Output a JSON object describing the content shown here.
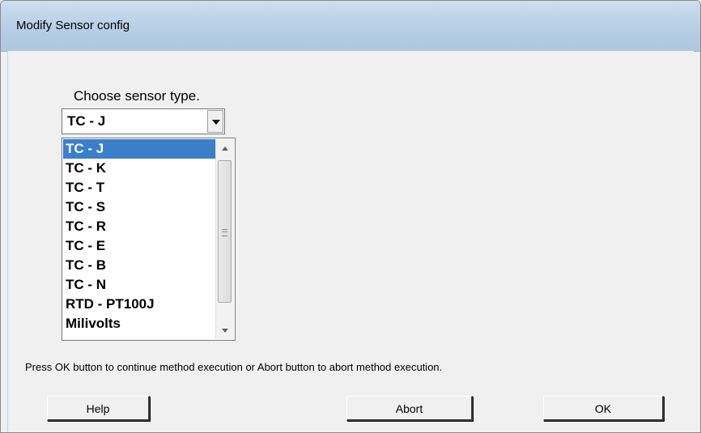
{
  "window": {
    "title": "Modify Sensor config"
  },
  "prompt": {
    "label": "Choose sensor type."
  },
  "combo": {
    "value": "TC - J"
  },
  "list": {
    "items": [
      "TC - J",
      "TC - K",
      "TC - T",
      "TC - S",
      "TC - R",
      "TC - E",
      "TC - B",
      "TC - N",
      "RTD - PT100J",
      "Milivolts"
    ],
    "selected_index": 0
  },
  "message": "Press OK button to continue method execution or Abort button to abort method execution.",
  "buttons": {
    "help": "Help",
    "abort": "Abort",
    "ok": "OK"
  },
  "colors": {
    "selection": "#3a7fcc",
    "titlebar": "#b9d1ea"
  }
}
